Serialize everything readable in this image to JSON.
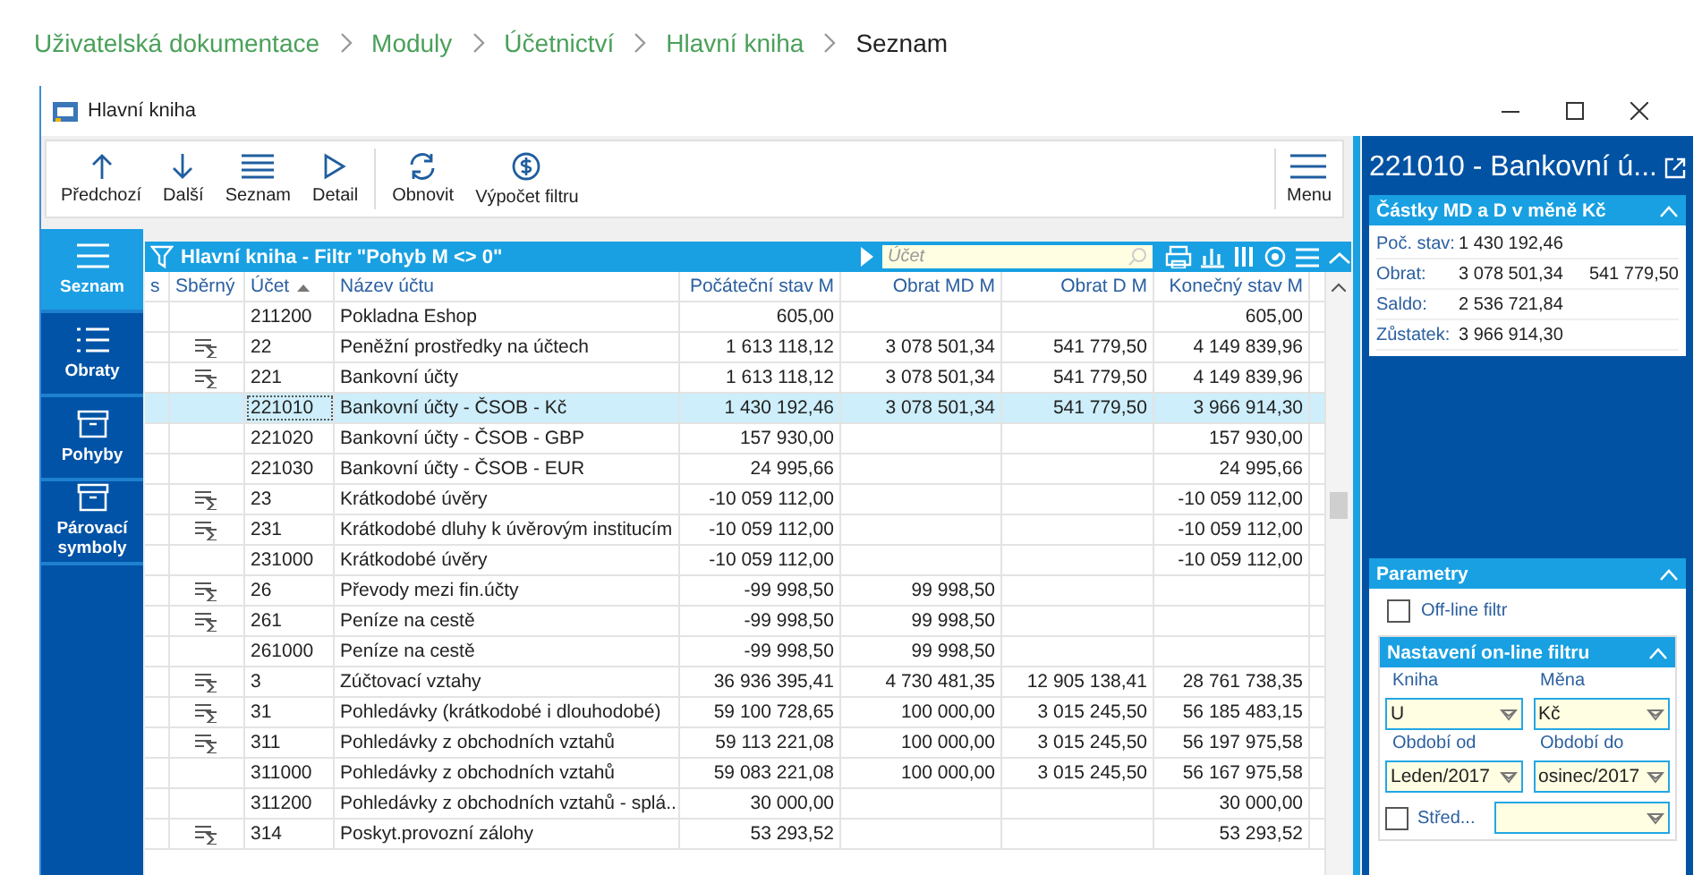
{
  "breadcrumb": [
    {
      "label": "Uživatelská dokumentace",
      "current": false
    },
    {
      "label": "Moduly",
      "current": false
    },
    {
      "label": "Účetnictví",
      "current": false
    },
    {
      "label": "Hlavní kniha",
      "current": false
    },
    {
      "label": "Seznam",
      "current": true
    }
  ],
  "window": {
    "title": "Hlavní kniha"
  },
  "toolbar": {
    "groups": [
      [
        {
          "label": "Předchozí",
          "kind": "up"
        },
        {
          "label": "Další",
          "kind": "down"
        },
        {
          "label": "Seznam",
          "kind": "list"
        },
        {
          "label": "Detail",
          "kind": "play"
        }
      ],
      [
        {
          "label": "Obnovit",
          "kind": "refresh"
        },
        {
          "label": "Výpočet filtru",
          "kind": "calc"
        }
      ]
    ],
    "menu": "Menu"
  },
  "nav": [
    {
      "label": "Seznam",
      "kind": "list",
      "selected": true
    },
    {
      "label": "Obraty",
      "kind": "bullets",
      "selected": false
    },
    {
      "label": "Pohyby",
      "kind": "box",
      "selected": false
    },
    {
      "label": "Párovací symboly",
      "kind": "box",
      "selected": false
    }
  ],
  "grid": {
    "title": "Hlavní kniha - Filtr \"Pohyb M <> 0\"",
    "search_placeholder": "Účet",
    "columns": [
      {
        "label": "s",
        "sorted": false
      },
      {
        "label": "Sběrný",
        "sorted": false
      },
      {
        "label": "Účet",
        "sorted": true
      },
      {
        "label": "Název účtu",
        "sorted": false
      },
      {
        "label": "Počáteční stav M",
        "sorted": false
      },
      {
        "label": "Obrat MD M",
        "sorted": false
      },
      {
        "label": "Obrat D M",
        "sorted": false
      },
      {
        "label": "Konečný stav M",
        "sorted": false
      }
    ],
    "rows": [
      {
        "collector": false,
        "selected": false,
        "account": "211200",
        "name": "Pokladna Eshop",
        "opening": "605,00",
        "closing": "605,00"
      },
      {
        "collector": true,
        "selected": false,
        "account": "22",
        "name": "Peněžní prostředky na účtech",
        "opening": "1 613 118,12",
        "debit": "3 078 501,34",
        "credit": "541 779,50",
        "closing": "4 149 839,96"
      },
      {
        "collector": true,
        "selected": false,
        "account": "221",
        "name": "Bankovní účty",
        "opening": "1 613 118,12",
        "debit": "3 078 501,34",
        "credit": "541 779,50",
        "closing": "4 149 839,96"
      },
      {
        "collector": false,
        "selected": true,
        "account": "221010",
        "name": "Bankovní účty - ČSOB - Kč",
        "opening": "1 430 192,46",
        "debit": "3 078 501,34",
        "credit": "541 779,50",
        "closing": "3 966 914,30"
      },
      {
        "collector": false,
        "selected": false,
        "account": "221020",
        "name": "Bankovní účty - ČSOB - GBP",
        "opening": "157 930,00",
        "closing": "157 930,00"
      },
      {
        "collector": false,
        "selected": false,
        "account": "221030",
        "name": "Bankovní účty - ČSOB - EUR",
        "opening": "24 995,66",
        "closing": "24 995,66"
      },
      {
        "collector": true,
        "selected": false,
        "account": "23",
        "name": "Krátkodobé úvěry",
        "opening": "-10 059 112,00",
        "closing": "-10 059 112,00"
      },
      {
        "collector": true,
        "selected": false,
        "account": "231",
        "name": "Krátkodobé dluhy k úvěrovým institucím",
        "opening": "-10 059 112,00",
        "closing": "-10 059 112,00"
      },
      {
        "collector": false,
        "selected": false,
        "account": "231000",
        "name": "Krátkodobé úvěry",
        "opening": "-10 059 112,00",
        "closing": "-10 059 112,00"
      },
      {
        "collector": true,
        "selected": false,
        "account": "26",
        "name": "Převody mezi fin.účty",
        "opening": "-99 998,50",
        "debit": "99 998,50"
      },
      {
        "collector": true,
        "selected": false,
        "account": "261",
        "name": "Peníze na cestě",
        "opening": "-99 998,50",
        "debit": "99 998,50"
      },
      {
        "collector": false,
        "selected": false,
        "account": "261000",
        "name": "Peníze na cestě",
        "opening": "-99 998,50",
        "debit": "99 998,50"
      },
      {
        "collector": true,
        "selected": false,
        "account": "3",
        "name": "Zúčtovací vztahy",
        "opening": "36 936 395,41",
        "debit": "4 730 481,35",
        "credit": "12 905 138,41",
        "closing": "28 761 738,35"
      },
      {
        "collector": true,
        "selected": false,
        "account": "31",
        "name": "Pohledávky (krátkodobé i dlouhodobé)",
        "opening": "59 100 728,65",
        "debit": "100 000,00",
        "credit": "3 015 245,50",
        "closing": "56 185 483,15"
      },
      {
        "collector": true,
        "selected": false,
        "account": "311",
        "name": "Pohledávky z obchodních vztahů",
        "opening": "59 113 221,08",
        "debit": "100 000,00",
        "credit": "3 015 245,50",
        "closing": "56 197 975,58"
      },
      {
        "collector": false,
        "selected": false,
        "account": "311000",
        "name": "Pohledávky z obchodních vztahů",
        "opening": "59 083 221,08",
        "debit": "100 000,00",
        "credit": "3 015 245,50",
        "closing": "56 167 975,58"
      },
      {
        "collector": false,
        "selected": false,
        "account": "311200",
        "name": "Pohledávky z obchodních vztahů - splá...",
        "opening": "30 000,00",
        "closing": "30 000,00"
      },
      {
        "collector": true,
        "selected": false,
        "account": "314",
        "name": "Poskyt.provozní zálohy",
        "opening": "53 293,52",
        "closing": "53 293,52"
      }
    ]
  },
  "detail": {
    "title": "221010 - Bankovní ú...",
    "amounts_title": "Částky MD a D v měně Kč",
    "amounts": [
      {
        "label": "Poč. stav:",
        "values": [
          "1 430 192,46"
        ]
      },
      {
        "label": "Obrat:",
        "values": [
          "3 078 501,34",
          "541 779,50"
        ]
      },
      {
        "label": "Saldo:",
        "values": [
          "2 536 721,84"
        ]
      },
      {
        "label": "Zůstatek:",
        "values": [
          "3 966 914,30"
        ]
      }
    ]
  },
  "params": {
    "title": "Parametry",
    "offline": {
      "label": "Off-line filtr",
      "checked": false
    },
    "online_title": "Nastavení on-line filtru",
    "fields": [
      {
        "label": "Kniha",
        "value": "U"
      },
      {
        "label": "Měna",
        "value": "Kč"
      },
      {
        "label": "Období od",
        "value": "Leden/2017"
      },
      {
        "label": "Období do",
        "value": "osinec/2017"
      }
    ],
    "extra": [
      {
        "label": "Střed...",
        "checked": false
      }
    ]
  }
}
